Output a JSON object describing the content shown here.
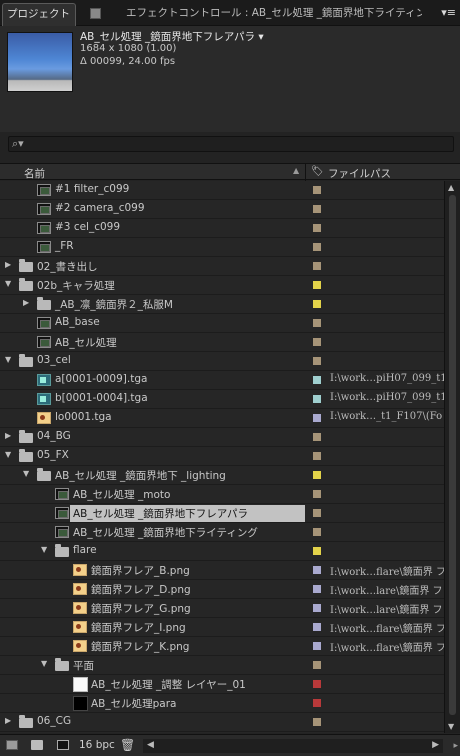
{
  "tabs": {
    "project_label": "プロジェクト",
    "project_close": "×",
    "effect_label": "エフェクトコントロール : AB_セル処理 _鏡面界地下ライティング",
    "menu_glyph": "▾≡"
  },
  "selected_item": {
    "name": "AB_セル処理 _鏡面界地下フレアパラ ▾",
    "dimensions": "1684 x 1080 (1.00)",
    "duration": "Δ 00099, 24.00 fps"
  },
  "search": {
    "placeholder": "",
    "icon": "search-icon"
  },
  "columns": {
    "name": "名前",
    "path": "ファイルパス"
  },
  "label_colors": {
    "tan": "#a69478",
    "yellow": "#e3d34a",
    "aqua": "#9fcfcf",
    "lavender": "#a9a9cf",
    "red": "#b8393a"
  },
  "items": [
    {
      "name": "#1 filter_c099",
      "indent": 1,
      "type": "comp",
      "label": "tan",
      "path": ""
    },
    {
      "name": "#2 camera_c099",
      "indent": 1,
      "type": "comp",
      "label": "tan",
      "path": ""
    },
    {
      "name": "#3 cel_c099",
      "indent": 1,
      "type": "comp",
      "label": "tan",
      "path": ""
    },
    {
      "name": "_FR",
      "indent": 1,
      "type": "comp",
      "label": "tan",
      "path": ""
    },
    {
      "name": "02_書き出し",
      "indent": 0,
      "type": "folder",
      "expanded": false,
      "label": "tan",
      "path": ""
    },
    {
      "name": "02b_キャラ処理",
      "indent": 0,
      "type": "folder",
      "expanded": true,
      "label": "yellow",
      "path": ""
    },
    {
      "name": "_AB_凛_鏡面界２_私服M",
      "indent": 1,
      "type": "folder",
      "expanded": false,
      "label": "yellow",
      "path": ""
    },
    {
      "name": "AB_base",
      "indent": 1,
      "type": "comp",
      "label": "tan",
      "path": ""
    },
    {
      "name": "AB_セル処理",
      "indent": 1,
      "type": "comp",
      "label": "tan",
      "path": ""
    },
    {
      "name": "03_cel",
      "indent": 0,
      "type": "folder",
      "expanded": true,
      "label": "tan",
      "path": ""
    },
    {
      "name": "a[0001-0009].tga",
      "indent": 1,
      "type": "seq",
      "label": "aqua",
      "path": "I:\\work…piH07_099_t1"
    },
    {
      "name": "b[0001-0004].tga",
      "indent": 1,
      "type": "seq",
      "label": "aqua",
      "path": "I:\\work…piH07_099_t1"
    },
    {
      "name": "lo0001.tga",
      "indent": 1,
      "type": "png",
      "label": "lavender",
      "path": "I:\\work…_t1_F107\\(Fo"
    },
    {
      "name": "04_BG",
      "indent": 0,
      "type": "folder",
      "expanded": false,
      "label": "tan",
      "path": ""
    },
    {
      "name": "05_FX",
      "indent": 0,
      "type": "folder",
      "expanded": true,
      "label": "tan",
      "path": ""
    },
    {
      "name": "AB_セル処理 _鏡面界地下 _lighting",
      "indent": 1,
      "type": "folder",
      "expanded": true,
      "label": "yellow",
      "path": ""
    },
    {
      "name": "AB_セル処理 _moto",
      "indent": 2,
      "type": "comp",
      "label": "tan",
      "path": ""
    },
    {
      "name": "AB_セル処理 _鏡面界地下フレアパラ",
      "indent": 2,
      "type": "comp",
      "label": "tan",
      "path": "",
      "selected": true
    },
    {
      "name": "AB_セル処理 _鏡面界地下ライティング",
      "indent": 2,
      "type": "comp",
      "label": "tan",
      "path": ""
    },
    {
      "name": "flare",
      "indent": 2,
      "type": "folder",
      "expanded": true,
      "label": "yellow",
      "path": ""
    },
    {
      "name": "鏡面界フレア_B.png",
      "indent": 3,
      "type": "png",
      "label": "lavender",
      "path": "I:\\work…flare\\鏡面界 フ"
    },
    {
      "name": "鏡面界フレア_D.png",
      "indent": 3,
      "type": "png",
      "label": "lavender",
      "path": "I:\\work…lare\\鏡面界 フ"
    },
    {
      "name": "鏡面界フレア_G.png",
      "indent": 3,
      "type": "png",
      "label": "lavender",
      "path": "I:\\work…lare\\鏡面界 フ"
    },
    {
      "name": "鏡面界フレア_I.png",
      "indent": 3,
      "type": "png",
      "label": "lavender",
      "path": "I:\\work…flare\\鏡面界 フ"
    },
    {
      "name": "鏡面界フレア_K.png",
      "indent": 3,
      "type": "png",
      "label": "lavender",
      "path": "I:\\work…flare\\鏡面界 フ"
    },
    {
      "name": "平面",
      "indent": 2,
      "type": "folder",
      "expanded": true,
      "label": "tan",
      "path": ""
    },
    {
      "name": "AB_セル処理 _調整 レイヤー_01",
      "indent": 3,
      "type": "solid-white",
      "label": "red",
      "path": ""
    },
    {
      "name": "AB_セル処理para",
      "indent": 3,
      "type": "solid-black",
      "label": "red",
      "path": ""
    },
    {
      "name": "06_CG",
      "indent": 0,
      "type": "folder",
      "expanded": false,
      "label": "tan",
      "path": ""
    }
  ],
  "footer": {
    "bpc": "16 bpc",
    "icons": [
      "interpret-footage-icon",
      "new-folder-icon",
      "new-comp-icon",
      "trash-icon"
    ]
  }
}
